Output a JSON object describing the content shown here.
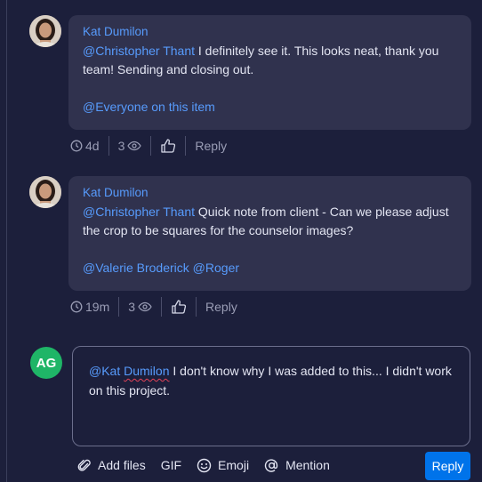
{
  "comments": [
    {
      "author": "Kat Dumilon",
      "mention": "@Christopher Thant",
      "text_line1_rest": " I definitely see it. This looks neat, thank you",
      "text_line2": "team! Sending and closing out.",
      "footer_mention": "@Everyone on this item",
      "time": "4d",
      "views": "3",
      "reply_label": "Reply"
    },
    {
      "author": "Kat Dumilon",
      "mention": "@Christopher Thant",
      "text_line1_rest": " Quick note from client - Can we please adjust",
      "text_line2": "the crop to be squares for the counselor images?",
      "footer_mention_1": "@Valerie Broderick",
      "footer_mention_2": "@Roger",
      "time": "19m",
      "views": "3",
      "reply_label": "Reply"
    }
  ],
  "composer": {
    "avatar_initials": "AG",
    "mention_prefix": "@Kat ",
    "mention_misspelled": "Dumilon",
    "text_line1_rest": " I don't know why I was added to this... I didn't work",
    "text_line2": "on this project."
  },
  "toolbar": {
    "add_files": "Add files",
    "gif": "GIF",
    "emoji": "Emoji",
    "mention": "Mention",
    "reply_button": "Reply"
  },
  "colors": {
    "background": "#1c1f3b",
    "bubble": "#30324e",
    "mention": "#579bfc",
    "primary_button": "#0073ea",
    "avatar_green": "#1fb567"
  }
}
